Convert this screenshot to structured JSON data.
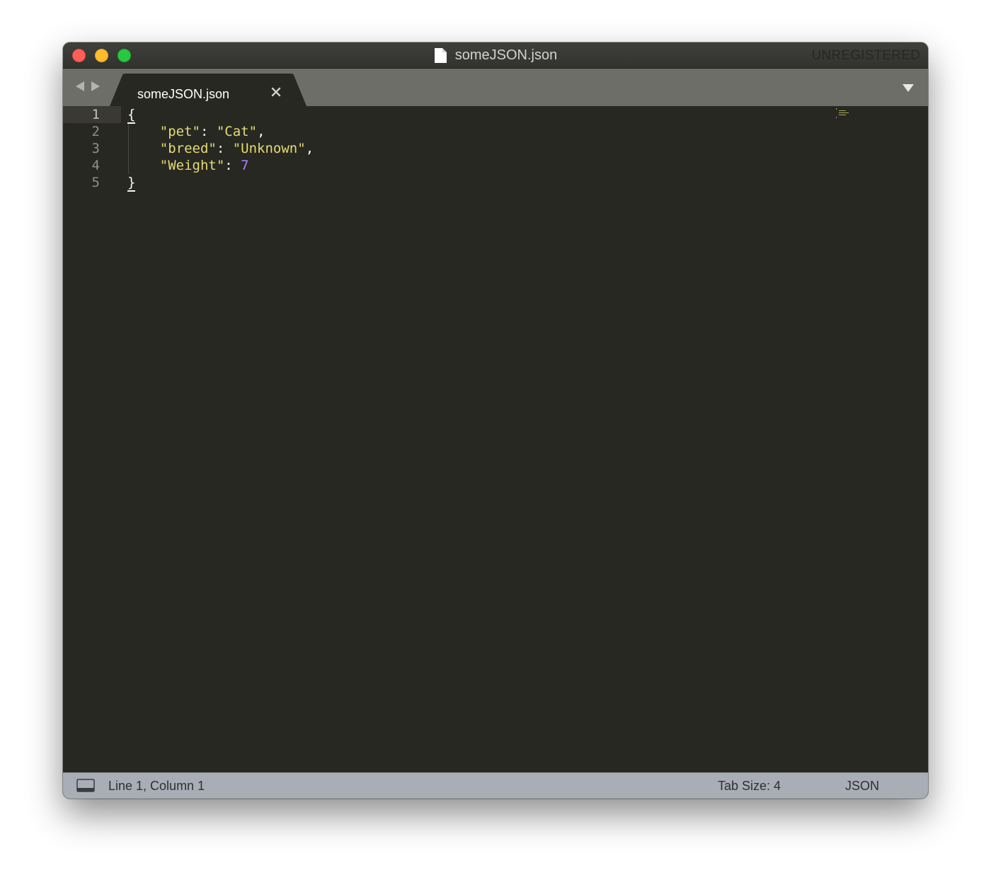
{
  "window": {
    "title": "someJSON.json",
    "registration_notice": "UNREGISTERED"
  },
  "tabs": [
    {
      "label": "someJSON.json",
      "active": true
    }
  ],
  "editor": {
    "line_numbers": [
      "1",
      "2",
      "3",
      "4",
      "5"
    ],
    "active_line": 1,
    "lines": [
      [
        {
          "text": "{",
          "kind": "brace"
        }
      ],
      [
        {
          "text": "    ",
          "kind": "punc"
        },
        {
          "text": "\"pet\"",
          "kind": "str"
        },
        {
          "text": ": ",
          "kind": "punc"
        },
        {
          "text": "\"Cat\"",
          "kind": "str"
        },
        {
          "text": ",",
          "kind": "punc"
        }
      ],
      [
        {
          "text": "    ",
          "kind": "punc"
        },
        {
          "text": "\"breed\"",
          "kind": "str"
        },
        {
          "text": ": ",
          "kind": "punc"
        },
        {
          "text": "\"Unknown\"",
          "kind": "str"
        },
        {
          "text": ",",
          "kind": "punc"
        }
      ],
      [
        {
          "text": "    ",
          "kind": "punc"
        },
        {
          "text": "\"Weight\"",
          "kind": "str"
        },
        {
          "text": ": ",
          "kind": "punc"
        },
        {
          "text": "7",
          "kind": "num"
        }
      ],
      [
        {
          "text": "}",
          "kind": "brace"
        }
      ]
    ]
  },
  "status_bar": {
    "position": "Line 1, Column 1",
    "tab_size": "Tab Size: 4",
    "syntax": "JSON"
  },
  "colors": {
    "background": "#272822",
    "string": "#e6db74",
    "number": "#ae81ff",
    "tab_bar": "#6d6e68",
    "status_bar": "#a9adb5"
  },
  "icons": {
    "close": "close-window-button",
    "minimize": "minimize-window-button",
    "zoom": "zoom-window-button",
    "document": "document-icon",
    "back": "nav-back-icon",
    "forward": "nav-forward-icon",
    "tab_close": "tab-close-icon",
    "tab_menu": "tab-list-dropdown-icon",
    "panel": "panel-toggle-icon"
  }
}
